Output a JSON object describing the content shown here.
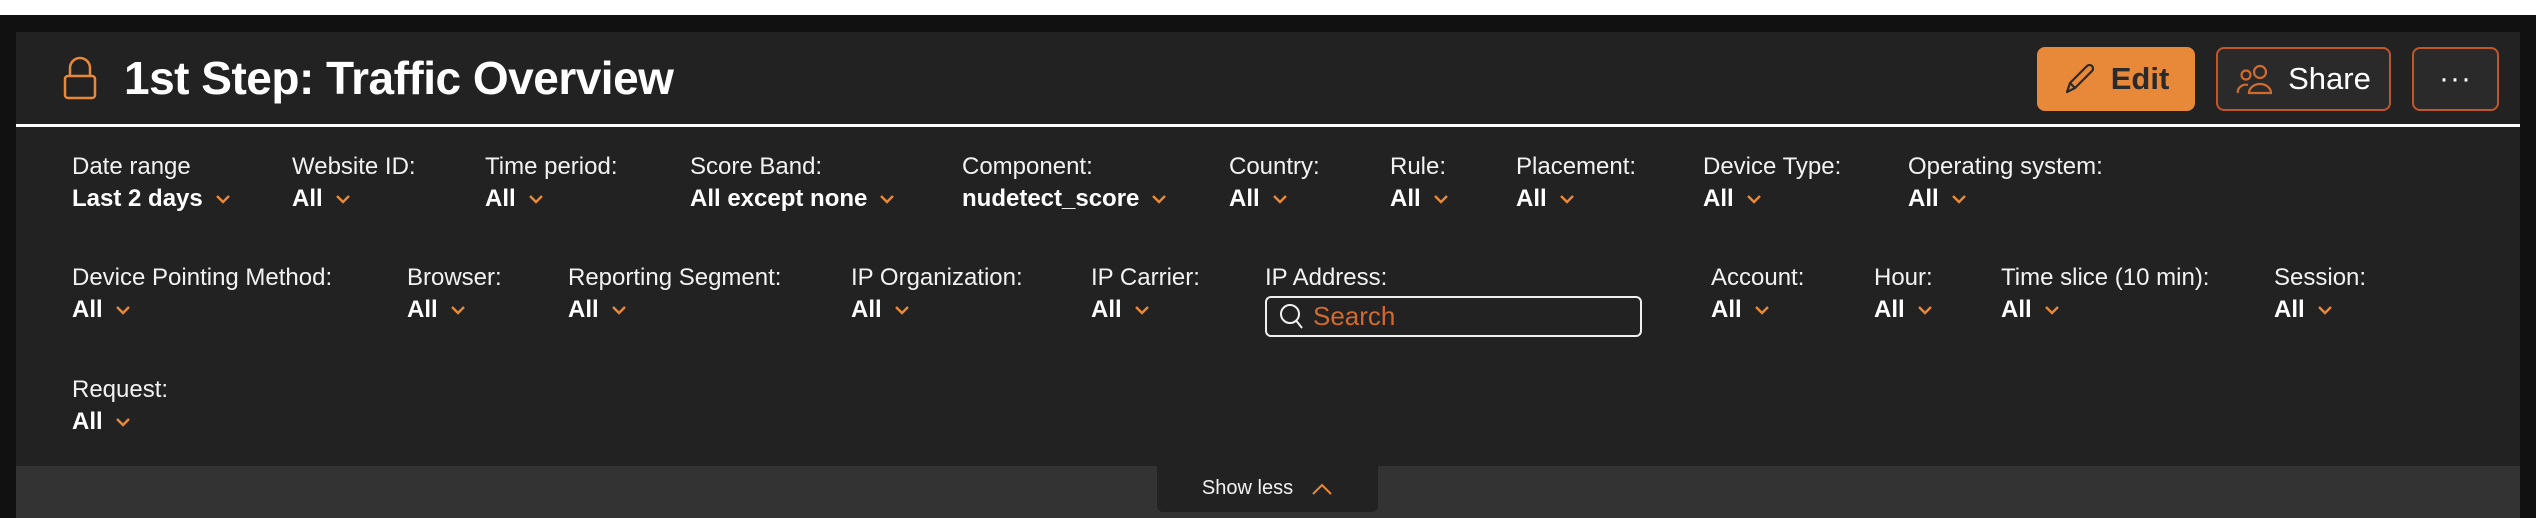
{
  "header": {
    "title": "1st Step: Traffic Overview",
    "lock_icon": "lock-icon",
    "buttons": {
      "edit": {
        "label": "Edit",
        "icon": "pencil-icon"
      },
      "share": {
        "label": "Share",
        "icon": "users-icon"
      },
      "more": {
        "label": "···",
        "icon": "more-icon"
      }
    }
  },
  "colors": {
    "accent": "#E8893A",
    "accent_border": "#C0562A",
    "panel_bg": "#222222",
    "page_bg": "#111111"
  },
  "filters": {
    "row1": [
      {
        "label": "Date range",
        "value": "Last 2 days"
      },
      {
        "label": "Website ID:",
        "value": "All"
      },
      {
        "label": "Time period:",
        "value": "All"
      },
      {
        "label": "Score Band:",
        "value": "All except none"
      },
      {
        "label": "Component:",
        "value": "nudetect_score"
      },
      {
        "label": "Country:",
        "value": "All"
      },
      {
        "label": "Rule:",
        "value": "All"
      },
      {
        "label": "Placement:",
        "value": "All"
      },
      {
        "label": "Device Type:",
        "value": "All"
      },
      {
        "label": "Operating system:",
        "value": "All"
      }
    ],
    "row2": [
      {
        "label": "Device Pointing Method:",
        "value": "All"
      },
      {
        "label": "Browser:",
        "value": "All"
      },
      {
        "label": "Reporting Segment:",
        "value": "All"
      },
      {
        "label": "IP Organization:",
        "value": "All"
      },
      {
        "label": "IP Carrier:",
        "value": "All"
      },
      {
        "label": "Account:",
        "value": "All"
      },
      {
        "label": "Hour:",
        "value": "All"
      },
      {
        "label": "Time slice (10 min):",
        "value": "All"
      },
      {
        "label": "Session:",
        "value": "All"
      }
    ],
    "row3": [
      {
        "label": "Request:",
        "value": "All"
      }
    ],
    "ip_address": {
      "label": "IP Address:",
      "value": "",
      "placeholder": "Search"
    }
  },
  "footer": {
    "show_less_label": "Show less"
  }
}
